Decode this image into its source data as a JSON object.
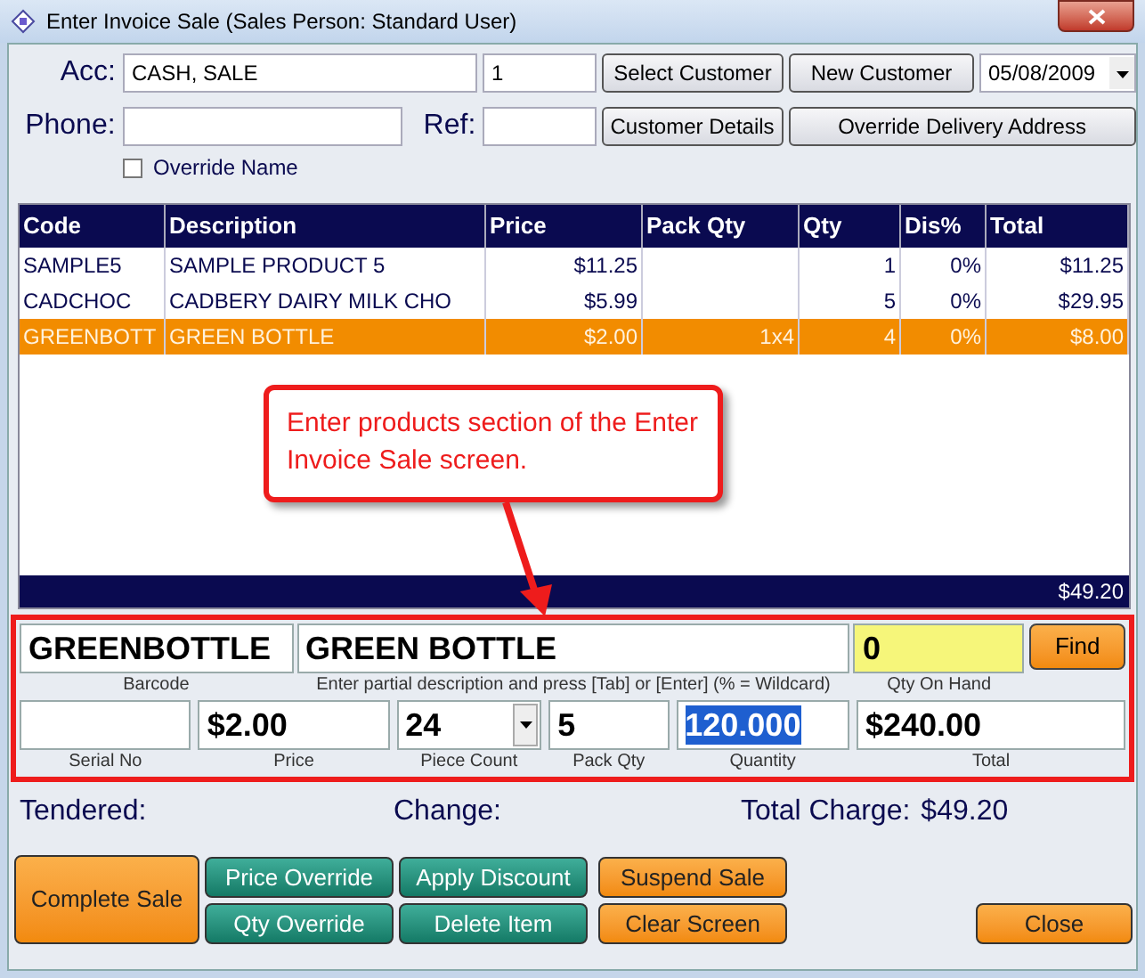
{
  "window": {
    "title": "Enter Invoice Sale (Sales Person: Standard User)"
  },
  "customer": {
    "acc_label": "Acc:",
    "acc_name": "CASH, SALE",
    "acc_number": "1",
    "phone_label": "Phone:",
    "ref_label": "Ref:",
    "date": "05/08/2009",
    "override_name": {
      "label": "Override Name",
      "checked": false
    }
  },
  "customer_buttons": [
    "Select Customer",
    "New Customer",
    "Customer Details",
    "Override Delivery Address"
  ],
  "table": {
    "columns": [
      "Code",
      "Description",
      "Price",
      "Pack Qty",
      "Qty",
      "Dis%",
      "Total"
    ],
    "rows": [
      {
        "cells": [
          "SAMPLE5",
          "SAMPLE PRODUCT 5",
          "$11.25",
          "",
          "1",
          "0%",
          "$11.25"
        ],
        "selected": false
      },
      {
        "cells": [
          "CADCHOC",
          "CADBERY DAIRY MILK CHO",
          "$5.99",
          "",
          "5",
          "0%",
          "$29.95"
        ],
        "selected": false
      },
      {
        "cells": [
          "GREENBOTT",
          "GREEN BOTTLE",
          "$2.00",
          "1x4",
          "4",
          "0%",
          "$8.00"
        ],
        "selected": true
      }
    ],
    "total": "$49.20"
  },
  "product_entry": {
    "row_1": [
      {
        "label": "Barcode",
        "value": "GREENBOTTLE",
        "kind": "text"
      },
      {
        "label": "Enter partial description and press [Tab] or [Enter] (% = Wildcard)",
        "value": "GREEN BOTTLE",
        "kind": "text"
      },
      {
        "label": "Qty On Hand",
        "value": "0",
        "kind": "highlight"
      }
    ],
    "find_button": "Find",
    "row_2": [
      {
        "label": "Serial No",
        "kind": "text"
      },
      {
        "label": "Price",
        "value": "$2.00",
        "kind": "text"
      },
      {
        "label": "Piece Count",
        "value": "24",
        "kind": "dropdown"
      },
      {
        "label": "Pack Qty",
        "value": "5",
        "kind": "text"
      },
      {
        "label": "Quantity",
        "value": "120.000",
        "kind": "selected_text"
      },
      {
        "label": "Total",
        "value": "$240.00",
        "kind": "text"
      }
    ]
  },
  "summary": {
    "tendered": "Tendered:",
    "change": "Change:",
    "total_charge_label": "Total Charge:",
    "total_charge": "$49.20"
  },
  "actions": [
    {
      "label": "Complete Sale",
      "kind": "orange"
    },
    {
      "label": "Price Override",
      "kind": "teal"
    },
    {
      "label": "Qty Override",
      "kind": "teal"
    },
    {
      "label": "Apply Discount",
      "kind": "teal"
    },
    {
      "label": "Delete Item",
      "kind": "teal"
    },
    {
      "label": "Suspend Sale",
      "kind": "orange"
    },
    {
      "label": "Clear Screen",
      "kind": "orange"
    },
    {
      "label": "Close",
      "kind": "orange"
    }
  ],
  "callout": "Enter products section of the Enter Invoice Sale screen."
}
